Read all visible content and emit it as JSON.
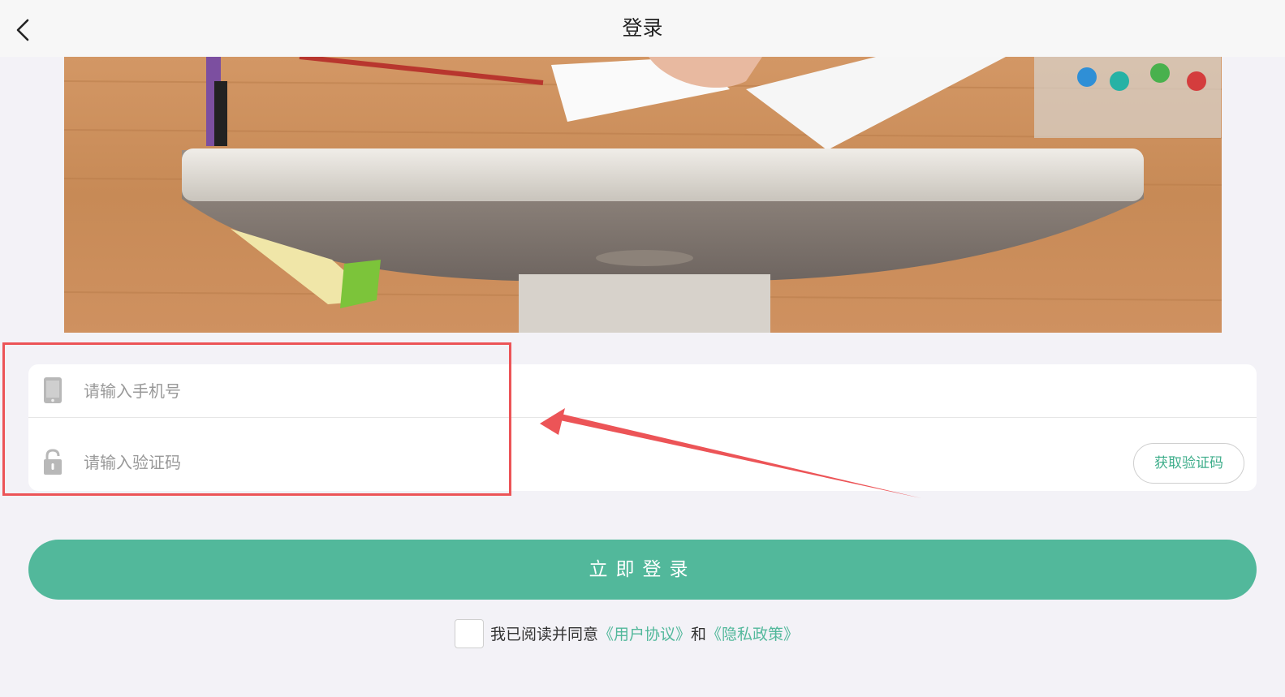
{
  "header": {
    "title": "登录",
    "back_icon": "chevron-left-icon"
  },
  "form": {
    "phone_placeholder": "请输入手机号",
    "code_placeholder": "请输入验证码",
    "get_code_label": "获取验证码",
    "phone_icon": "phone-icon",
    "lock_icon": "lock-icon"
  },
  "login_button": "立即登录",
  "agreement": {
    "prefix": "我已阅读并同意",
    "user_agreement": "《用户协议》",
    "and": "和",
    "privacy_policy": "《隐私政策》",
    "checked": false
  },
  "colors": {
    "accent": "#52b89b",
    "link": "#3fae8b",
    "annotation": "#ec5457",
    "background": "#f3f2f7"
  }
}
